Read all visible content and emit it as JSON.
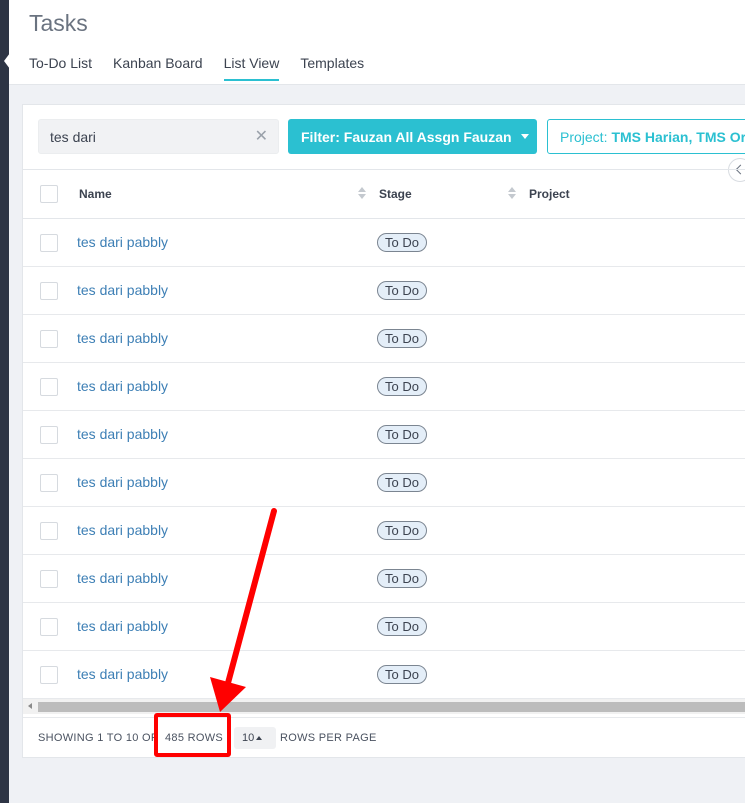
{
  "app": {
    "title": "Tasks",
    "tabs": [
      {
        "label": "To-Do List",
        "active": false
      },
      {
        "label": "Kanban Board",
        "active": false
      },
      {
        "label": "List View",
        "active": true
      },
      {
        "label": "Templates",
        "active": false
      }
    ]
  },
  "toolbar": {
    "search_value": "tes dari",
    "filter_label": "Filter: Fauzan All Assgn Fauzan",
    "project_prefix": "Project:",
    "project_value": "TMS Harian, TMS Or"
  },
  "table": {
    "columns": [
      "Name",
      "Stage",
      "Project"
    ],
    "rows": [
      {
        "name": "tes dari pabbly",
        "stage": "To Do",
        "project": ""
      },
      {
        "name": "tes dari pabbly",
        "stage": "To Do",
        "project": ""
      },
      {
        "name": "tes dari pabbly",
        "stage": "To Do",
        "project": ""
      },
      {
        "name": "tes dari pabbly",
        "stage": "To Do",
        "project": ""
      },
      {
        "name": "tes dari pabbly",
        "stage": "To Do",
        "project": ""
      },
      {
        "name": "tes dari pabbly",
        "stage": "To Do",
        "project": ""
      },
      {
        "name": "tes dari pabbly",
        "stage": "To Do",
        "project": ""
      },
      {
        "name": "tes dari pabbly",
        "stage": "To Do",
        "project": ""
      },
      {
        "name": "tes dari pabbly",
        "stage": "To Do",
        "project": ""
      },
      {
        "name": "tes dari pabbly",
        "stage": "To Do",
        "project": ""
      }
    ]
  },
  "pagination": {
    "showing": "SHOWING 1 TO 10 OF",
    "total": "485 ROWS",
    "per_page_value": "10",
    "per_page_label": "ROWS PER PAGE"
  },
  "colors": {
    "accent": "#2bc0d1",
    "link": "#3d7fb5",
    "sidebar": "#2d3444",
    "annotation": "#ff0000"
  }
}
